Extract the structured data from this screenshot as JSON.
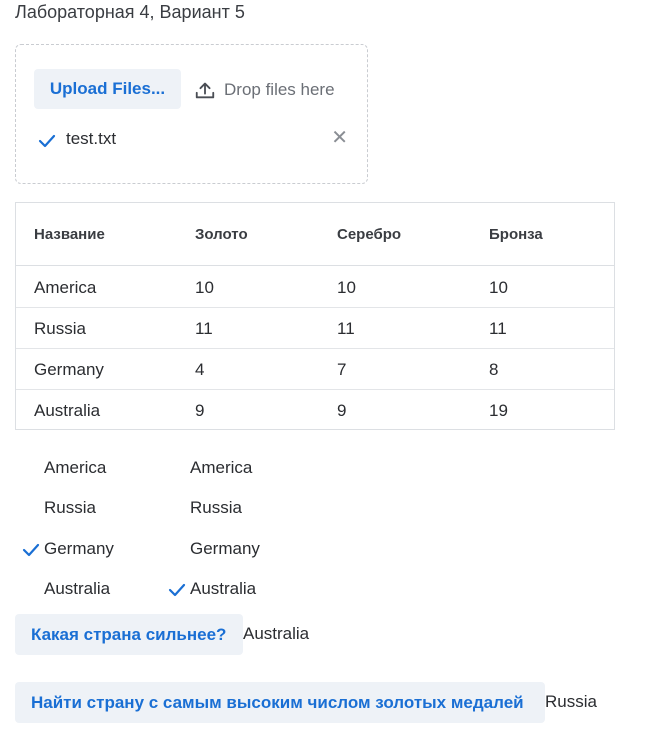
{
  "page_title": "Лабораторная 4, Вариант 5",
  "upload": {
    "button_label": "Upload Files...",
    "drop_label": "Drop files here",
    "files": [
      {
        "name": "test.txt",
        "status": "uploaded"
      }
    ],
    "remove_glyph": "✕"
  },
  "table": {
    "headers": [
      "Название",
      "Золото",
      "Серебро",
      "Бронза"
    ],
    "rows": [
      [
        "America",
        "10",
        "10",
        "10"
      ],
      [
        "Russia",
        "11",
        "11",
        "11"
      ],
      [
        "Germany",
        "4",
        "7",
        "8"
      ],
      [
        "Australia",
        "9",
        "9",
        "19"
      ]
    ]
  },
  "select_left": {
    "options": [
      "America",
      "Russia",
      "Germany",
      "Australia"
    ],
    "selected": "Germany"
  },
  "select_right": {
    "options": [
      "America",
      "Russia",
      "Germany",
      "Australia"
    ],
    "selected": "Australia"
  },
  "compare": {
    "button_label": "Какая страна сильнее?",
    "result": "Australia"
  },
  "max_gold": {
    "button_label": "Найти страну с самым высоким числом золотых медалей",
    "result": "Russia"
  },
  "colors": {
    "accent": "#1a6fd4",
    "button_bg": "#eef2f7",
    "border": "#dcdfe3"
  }
}
